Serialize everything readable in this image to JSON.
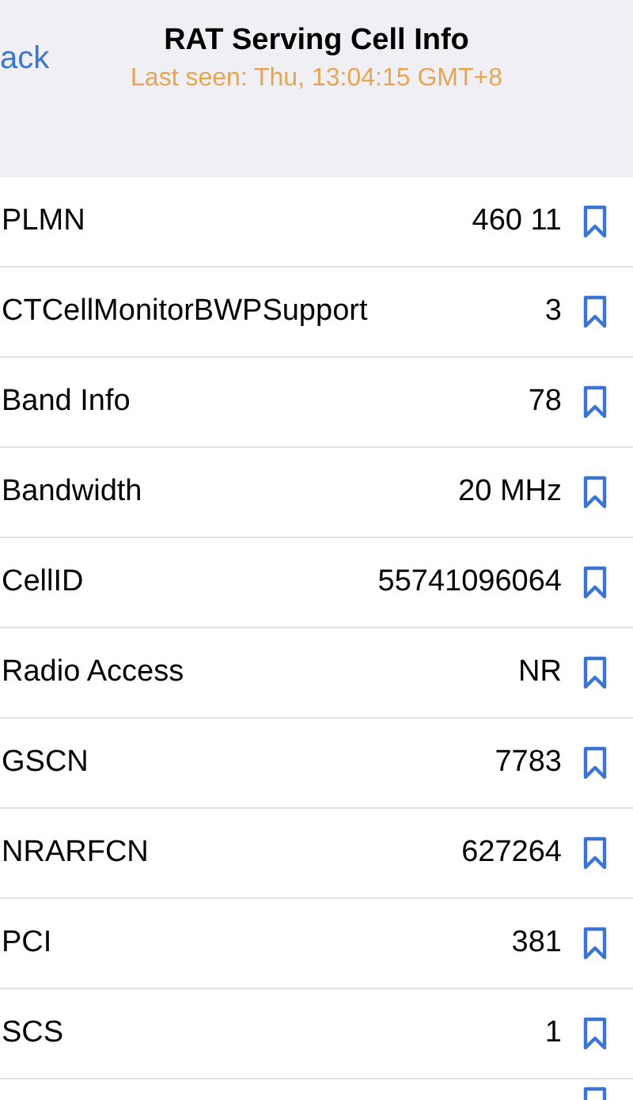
{
  "nav": {
    "back": "ack",
    "title": "RAT Serving Cell Info",
    "subtitle": "Last seen: Thu, 13:04:15 GMT+8"
  },
  "rows": [
    {
      "label": "PLMN",
      "value": "460 11"
    },
    {
      "label": "CTCellMonitorBWPSupport",
      "value": "3"
    },
    {
      "label": "Band Info",
      "value": "78"
    },
    {
      "label": "Bandwidth",
      "value": "20 MHz"
    },
    {
      "label": "CellID",
      "value": "55741096064"
    },
    {
      "label": "Radio Access",
      "value": "NR"
    },
    {
      "label": "GSCN",
      "value": "7783"
    },
    {
      "label": "NRARFCN",
      "value": "627264"
    },
    {
      "label": "PCI",
      "value": "381"
    },
    {
      "label": "SCS",
      "value": "1"
    }
  ]
}
